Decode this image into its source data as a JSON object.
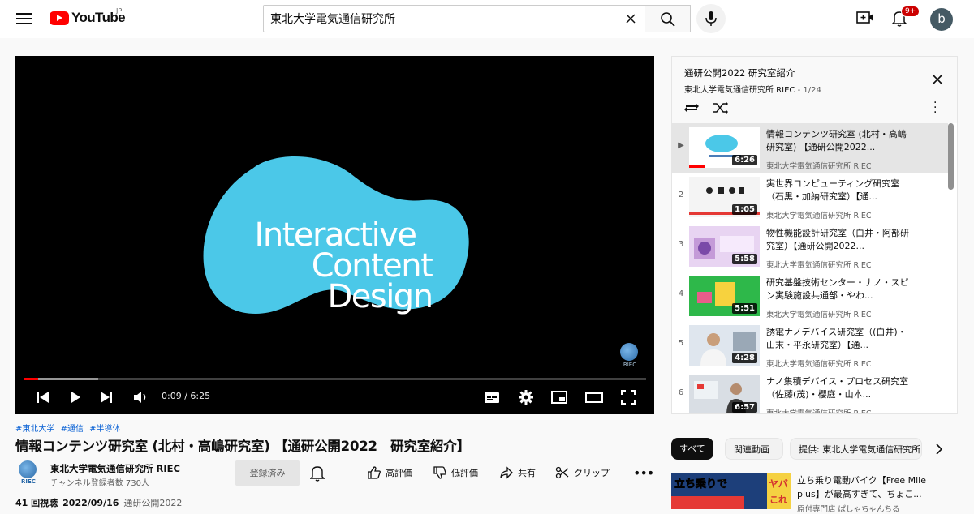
{
  "header": {
    "logo_text": "YouTube",
    "region": "JP",
    "search_value": "東北大学電気通信研究所",
    "notification_count": "9+",
    "avatar_letter": "b"
  },
  "player": {
    "time": "0:09 / 6:25",
    "progress_fraction": 0.023,
    "buffer_fraction": 0.12,
    "video_text_lines": [
      "Interactive",
      "Content",
      "Design"
    ],
    "watermark": "RIEC",
    "blob_color": "#4bc8e8"
  },
  "video": {
    "hashtags": [
      "#東北大学",
      "#通信",
      "#半導体"
    ],
    "title": "情報コンテンツ研究室 (北村・高嶋研究室) 【通研公開2022　研究室紹介】",
    "channel": "東北大学電気通信研究所 RIEC",
    "channel_avatar_text": "RIEC",
    "subscribers": "チャンネル登録者数 730人",
    "subscribe_label": "登録済み",
    "like_label": "高評価",
    "dislike_label": "低評価",
    "share_label": "共有",
    "clip_label": "クリップ",
    "views": "41 回視聴",
    "date": "2022/09/16",
    "tag": "通研公開2022"
  },
  "playlist": {
    "title": "通研公開2022 研究室紹介",
    "channel": "東北大学電気通信研究所 RIEC",
    "position": " - 1/24",
    "items": [
      {
        "index": "▶",
        "title": "情報コンテンツ研究室 (北村・高嶋研究室) 【通研公開2022...",
        "channel": "東北大学電気通信研究所 RIEC",
        "duration": "6:26"
      },
      {
        "index": "2",
        "title": "実世界コンピューティング研究室（石黒・加納研究室）【通...",
        "channel": "東北大学電気通信研究所 RIEC",
        "duration": "1:05"
      },
      {
        "index": "3",
        "title": "物性機能設計研究室（白井・阿部研究室）【通研公開2022...",
        "channel": "東北大学電気通信研究所 RIEC",
        "duration": "5:58"
      },
      {
        "index": "4",
        "title": "研究基盤技術センター・ナノ・スピン実験施設共通部・やわ...",
        "channel": "東北大学電気通信研究所 RIEC",
        "duration": "5:51"
      },
      {
        "index": "5",
        "title": "誘電ナノデバイス研究室（(白井)・山末・平永研究室）【通...",
        "channel": "東北大学電気通信研究所 RIEC",
        "duration": "4:28"
      },
      {
        "index": "6",
        "title": "ナノ集積デバイス・プロセス研究室（佐藤(茂)・櫻庭・山本...",
        "channel": "東北大学電気通信研究所 RIEC",
        "duration": "6:57"
      }
    ]
  },
  "chips": [
    "すべて",
    "関連動画",
    "提供: 東北大学電気通信研究所"
  ],
  "recommendation": {
    "title": "立ち乗り電動バイク【Free Mile plus】が最高すぎて、ちょこ...",
    "channel": "原付専門店 ぱしゃちゃんちる",
    "thumb_text_left": "立ち乗りで",
    "thumb_text_right": "ヤバ",
    "thumb_text_right2": "これ"
  }
}
